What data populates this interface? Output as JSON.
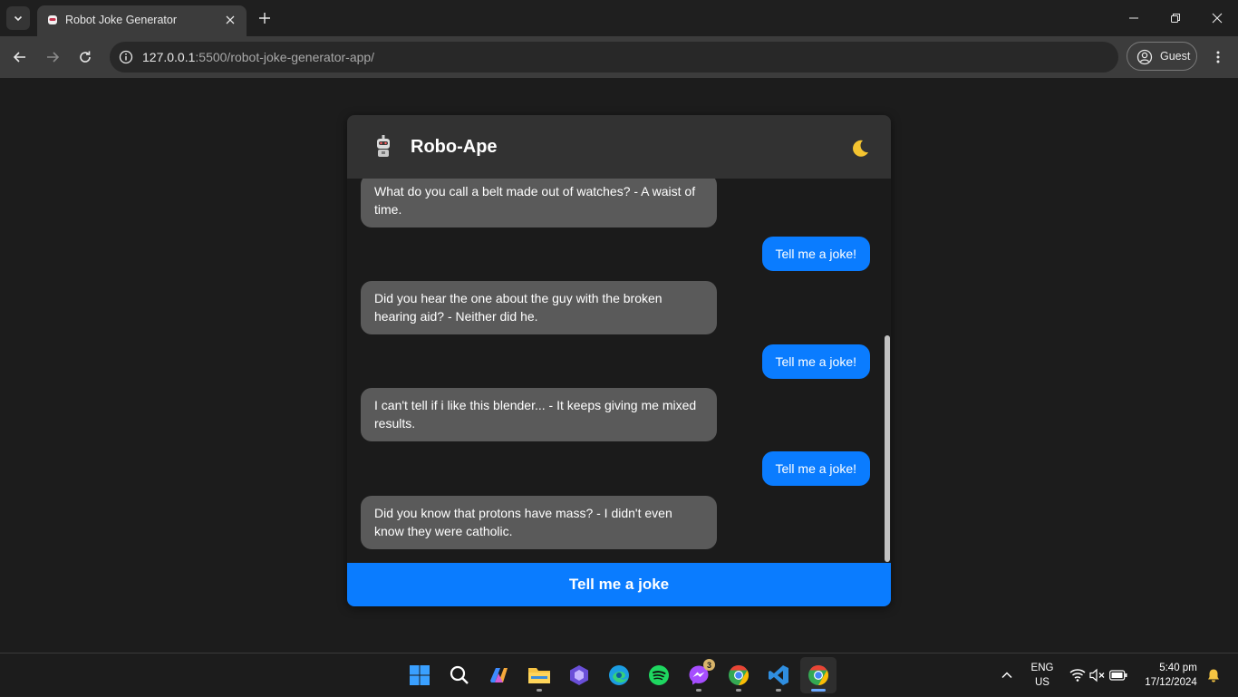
{
  "browser": {
    "tab_title": "Robot Joke Generator",
    "url_host": "127.0.0.1",
    "url_path": ":5500/robot-joke-generator-app/",
    "profile_label": "Guest"
  },
  "app": {
    "bot_name": "Robo-Ape",
    "theme_icon": "moon-icon",
    "messages": [
      {
        "role": "bot",
        "text": "What do you call a belt made out of watches? - A waist of time."
      },
      {
        "role": "user",
        "text": "Tell me a joke!"
      },
      {
        "role": "bot",
        "text": "Did you hear the one about the guy with the broken hearing aid? - Neither did he."
      },
      {
        "role": "user",
        "text": "Tell me a joke!"
      },
      {
        "role": "bot",
        "text": "I can't tell if i like this blender... - It keeps giving me mixed results."
      },
      {
        "role": "user",
        "text": "Tell me a joke!"
      },
      {
        "role": "bot",
        "text": "Did you know that protons have mass? - I didn't even know they were catholic."
      }
    ],
    "button_label": "Tell me a joke",
    "colors": {
      "accent": "#0a7cff",
      "bot_bubble": "#5a5a5a",
      "header": "#323232"
    }
  },
  "taskbar": {
    "apps": [
      "start-icon",
      "search-icon",
      "copilot-icon",
      "file-explorer-icon",
      "clipchamp-icon",
      "edge-icon",
      "spotify-icon",
      "messenger-icon",
      "chrome-icon",
      "vscode-icon",
      "chrome-active-icon"
    ],
    "messenger_badge": "3",
    "language_line1": "ENG",
    "language_line2": "US",
    "time": "5:40 pm",
    "date": "17/12/2024"
  }
}
